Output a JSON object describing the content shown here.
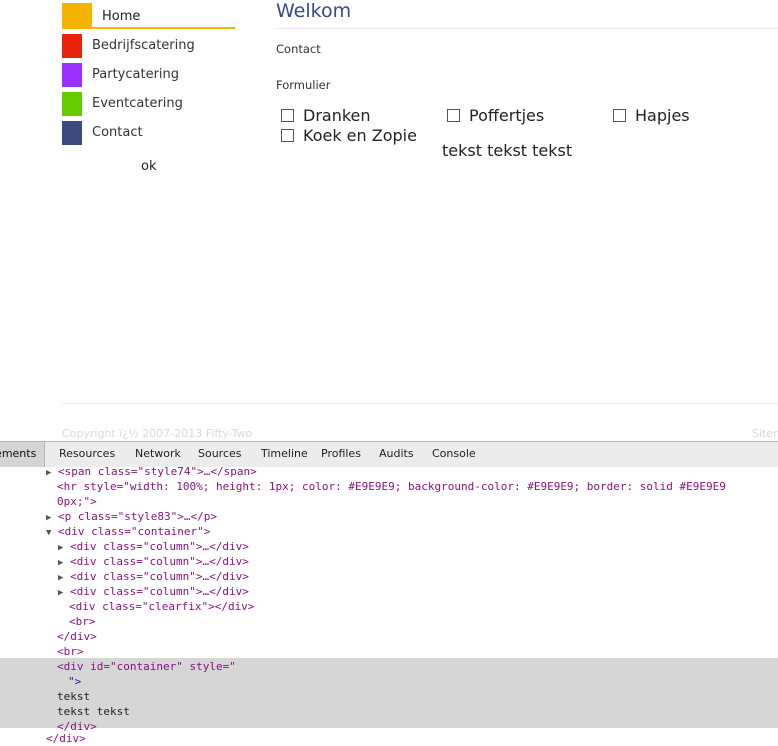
{
  "nav": {
    "items": [
      {
        "label": "Home",
        "color": "#F4B400"
      },
      {
        "label": "Bedrijfscatering",
        "color": "#E8220A"
      },
      {
        "label": "Partycatering",
        "color": "#9B30FF"
      },
      {
        "label": "Eventcatering",
        "color": "#66CC00"
      },
      {
        "label": "Contact",
        "color": "#3C4A7D"
      }
    ],
    "extra_text": "ok"
  },
  "main": {
    "title": "Welkom",
    "subtitle": "Contact",
    "form_heading": "Formulier",
    "checkboxes": [
      "Dranken",
      "Poffertjes",
      "Hapjes",
      "Koek en Zopie"
    ],
    "body_text": "tekst tekst tekst"
  },
  "footer": {
    "left": "Copyright ï¿½ 2007-2013 Fifty-Two",
    "right": "Siter"
  },
  "devtools": {
    "tabs": [
      "lements",
      "Resources",
      "Network",
      "Sources",
      "Timeline",
      "Profiles",
      "Audits",
      "Console"
    ],
    "lines": [
      "<span class=\"style74\">…</span>",
      "<hr style=\"width: 100%; height: 1px; color: #E9E9E9; background-color: #E9E9E9; border: solid #E9E9E9",
      "0px;\">",
      "<p class=\"style83\">…</p>",
      "<div class=\"container\">",
      "<div class=\"column\">…</div>",
      "<div class=\"column\">…</div>",
      "<div class=\"column\">…</div>",
      "<div class=\"column\">…</div>",
      "<div class=\"clearfix\"></div>",
      "<br>",
      "</div>",
      "<br>",
      "<div id=\"container\" style=\"",
      "\">",
      "tekst",
      "tekst tekst",
      "</div>",
      "</div>"
    ]
  }
}
